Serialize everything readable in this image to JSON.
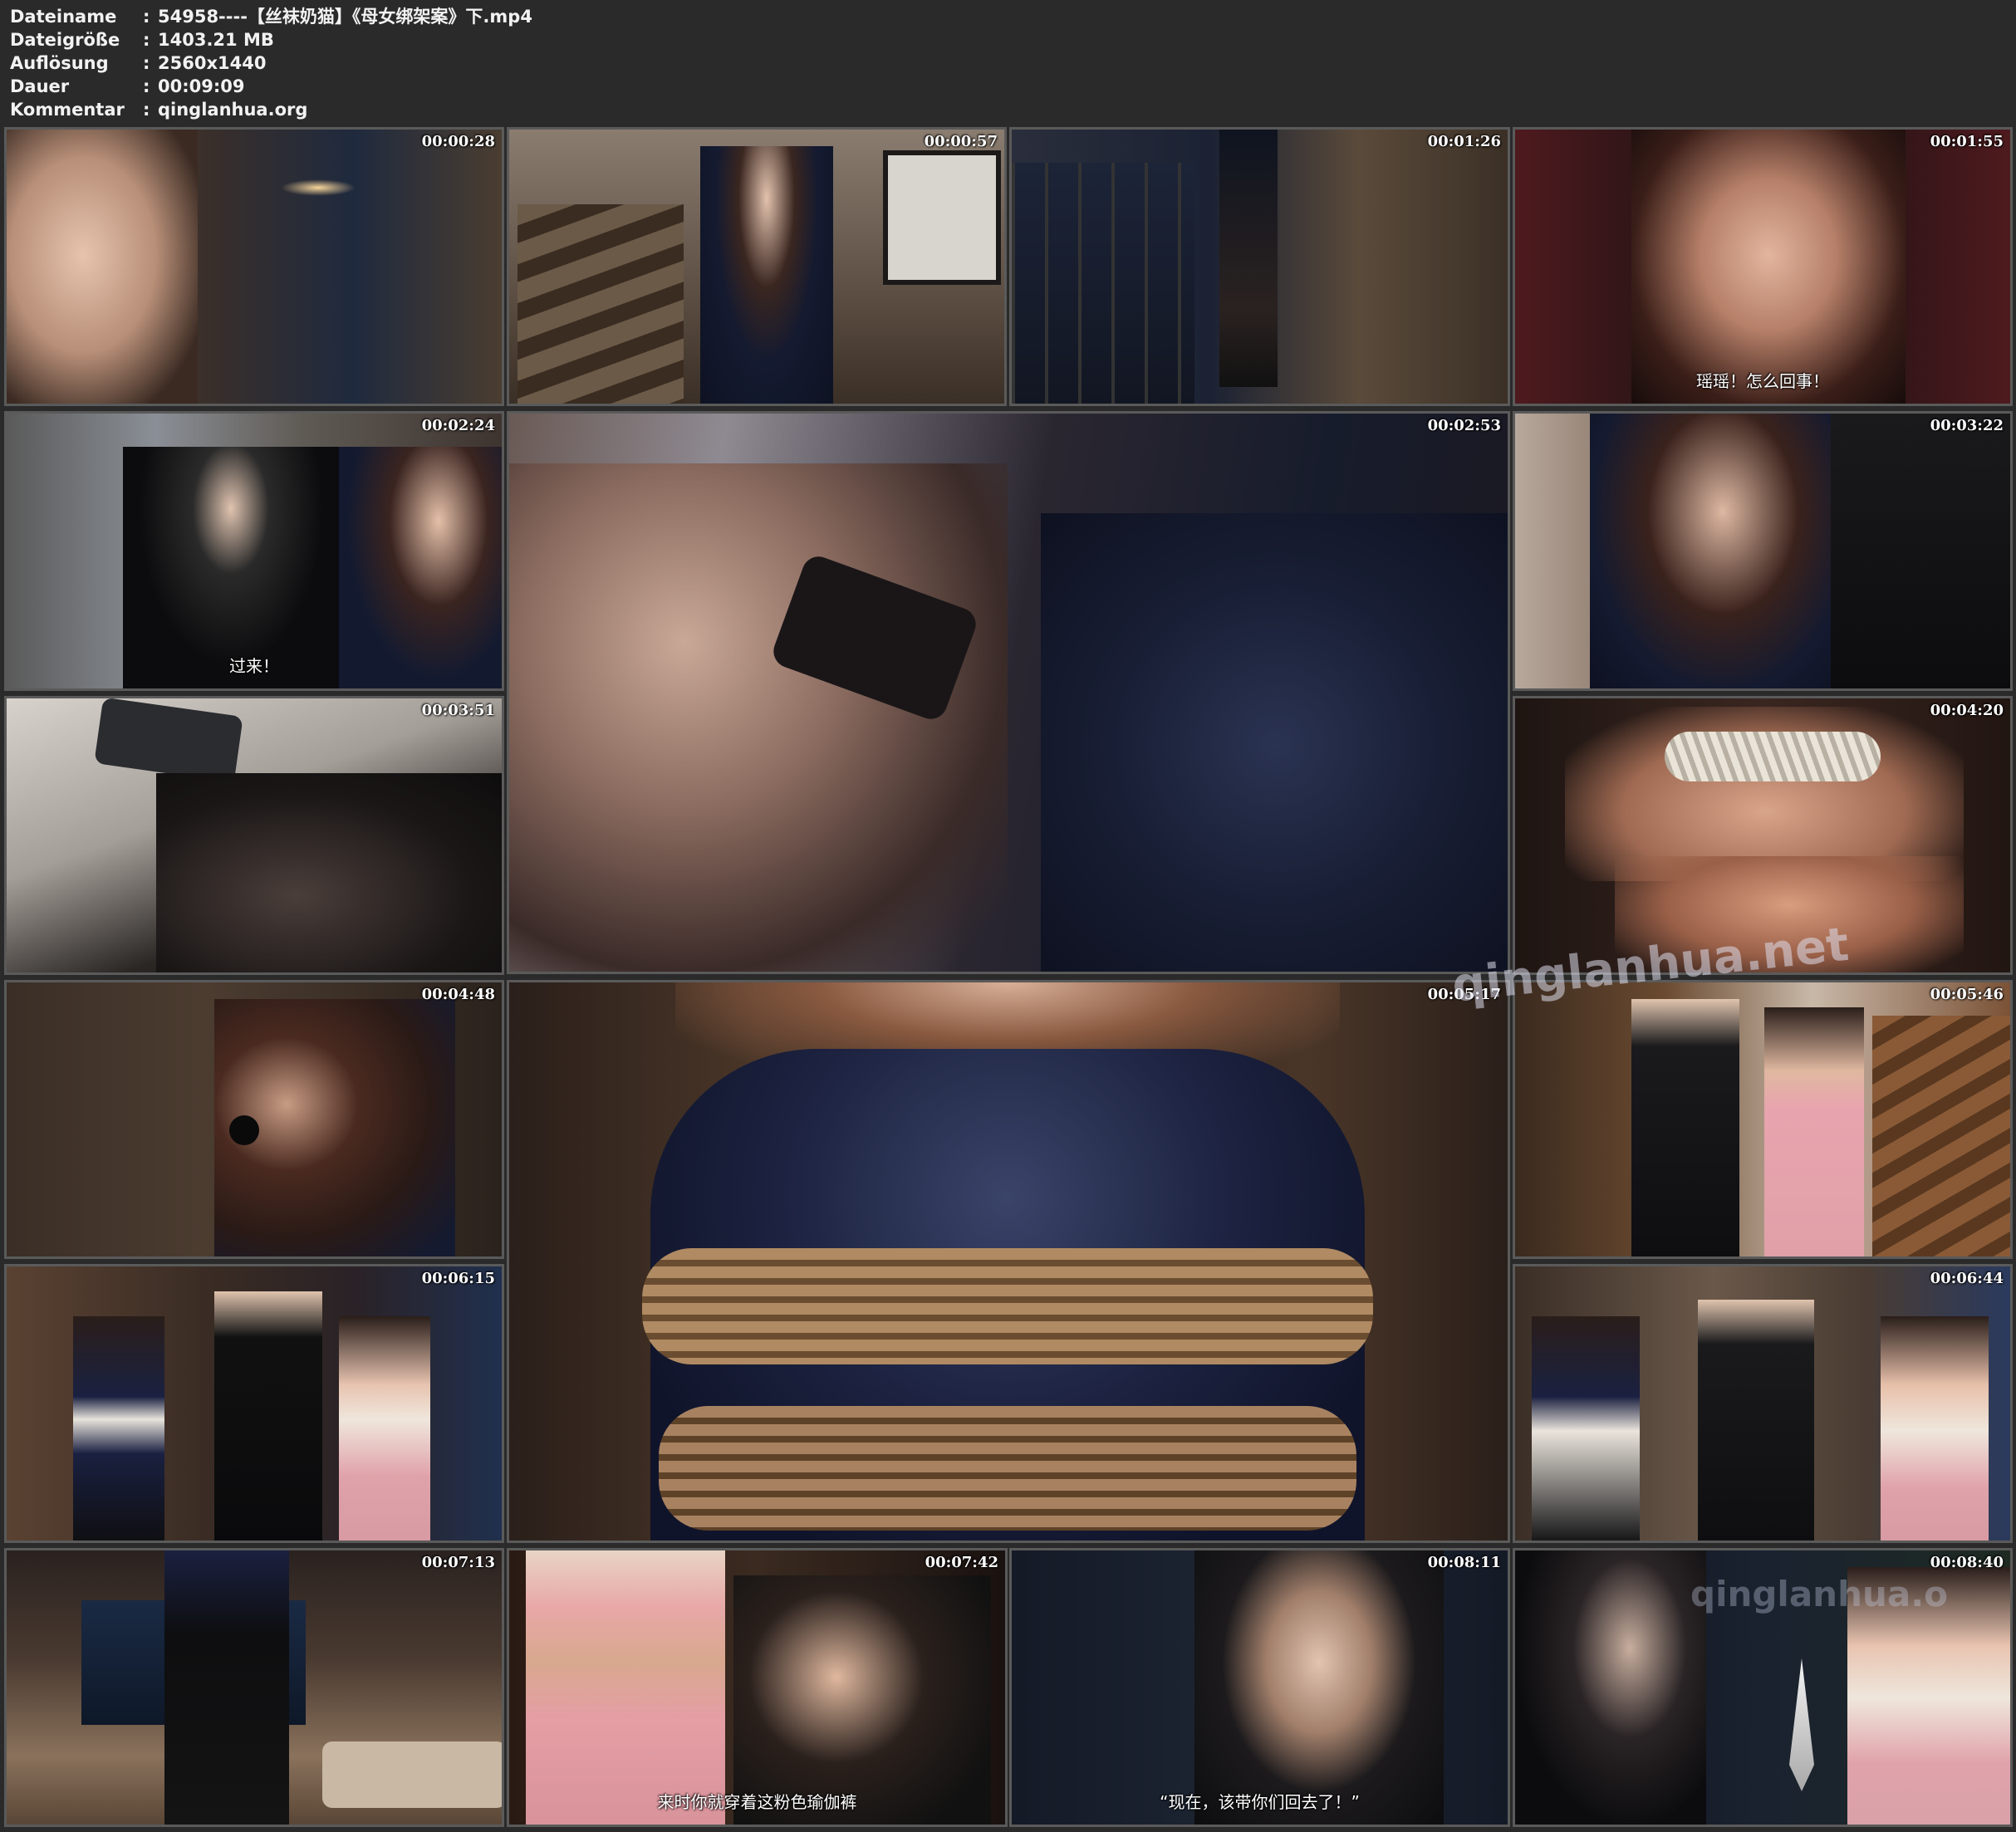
{
  "file_info": {
    "rows": [
      {
        "key": "Dateiname",
        "sep": ":",
        "value": "54958----【丝袜奶猫】《母女绑架案》下.mp4"
      },
      {
        "key": "Dateigröße",
        "sep": ":",
        "value": "1403.21 MB"
      },
      {
        "key": "Auflösung",
        "sep": ":",
        "value": "2560x1440"
      },
      {
        "key": "Dauer",
        "sep": ":",
        "value": "00:09:09"
      },
      {
        "key": "Kommentar",
        "sep": ":",
        "value": "qinglanhua.org"
      }
    ]
  },
  "thumbnails": [
    {
      "time": "00:00:28",
      "subtitle": ""
    },
    {
      "time": "00:00:57",
      "subtitle": ""
    },
    {
      "time": "00:01:26",
      "subtitle": ""
    },
    {
      "time": "00:01:55",
      "subtitle": "瑶瑶！怎么回事！"
    },
    {
      "time": "00:02:24",
      "subtitle": "过来！"
    },
    {
      "time": "00:02:53",
      "subtitle": ""
    },
    {
      "time": "00:03:22",
      "subtitle": ""
    },
    {
      "time": "00:03:51",
      "subtitle": ""
    },
    {
      "time": "00:04:20",
      "subtitle": ""
    },
    {
      "time": "00:04:48",
      "subtitle": ""
    },
    {
      "time": "00:05:17",
      "subtitle": ""
    },
    {
      "time": "00:05:46",
      "subtitle": ""
    },
    {
      "time": "00:06:15",
      "subtitle": ""
    },
    {
      "time": "00:06:44",
      "subtitle": ""
    },
    {
      "time": "00:07:13",
      "subtitle": ""
    },
    {
      "time": "00:07:42",
      "subtitle": "来时你就穿着这粉色瑜伽裤"
    },
    {
      "time": "00:08:11",
      "subtitle": "“现在，该带你们回去了！”"
    },
    {
      "time": "00:08:40",
      "subtitle": ""
    }
  ],
  "watermarks": {
    "main": "qinglanhua.net",
    "corner": "qinglanhua.o"
  }
}
